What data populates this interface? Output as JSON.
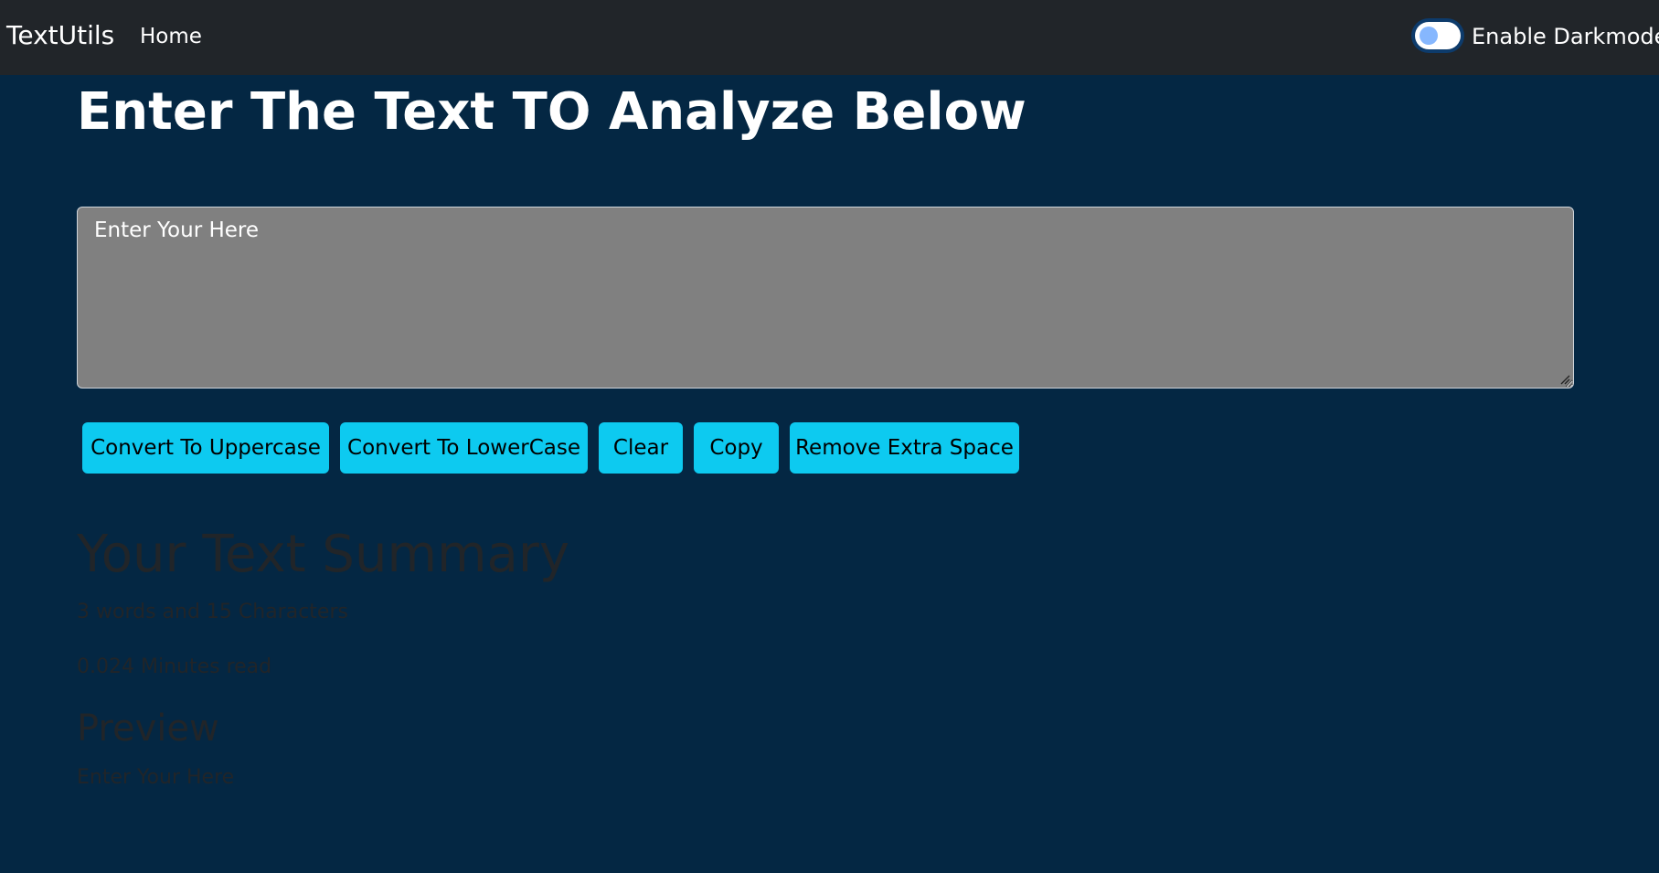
{
  "navbar": {
    "brand": "TextUtils",
    "links": [
      {
        "label": "Home"
      }
    ],
    "dark_mode_toggle": {
      "label": "Enable Darkmode",
      "checked": false
    }
  },
  "main": {
    "heading": "Enter The Text TO Analyze Below",
    "textarea": {
      "value": "",
      "placeholder": "Enter Your Here"
    },
    "buttons": [
      {
        "label": "Convert To Uppercase"
      },
      {
        "label": "Convert To LowerCase"
      },
      {
        "label": "Clear"
      },
      {
        "label": "Copy"
      },
      {
        "label": "Remove Extra Space"
      }
    ]
  },
  "summary": {
    "heading": "Your Text Summary",
    "counts": "3 words and 15 Characters",
    "read_time": "0.024 Minutes read",
    "preview_heading": "Preview",
    "preview_text": "Enter Your Here"
  },
  "colors": {
    "background": "#042743",
    "navbar": "#212529",
    "button": "#0dcaf0",
    "textarea": "#808080",
    "muted_text": "#212529"
  }
}
